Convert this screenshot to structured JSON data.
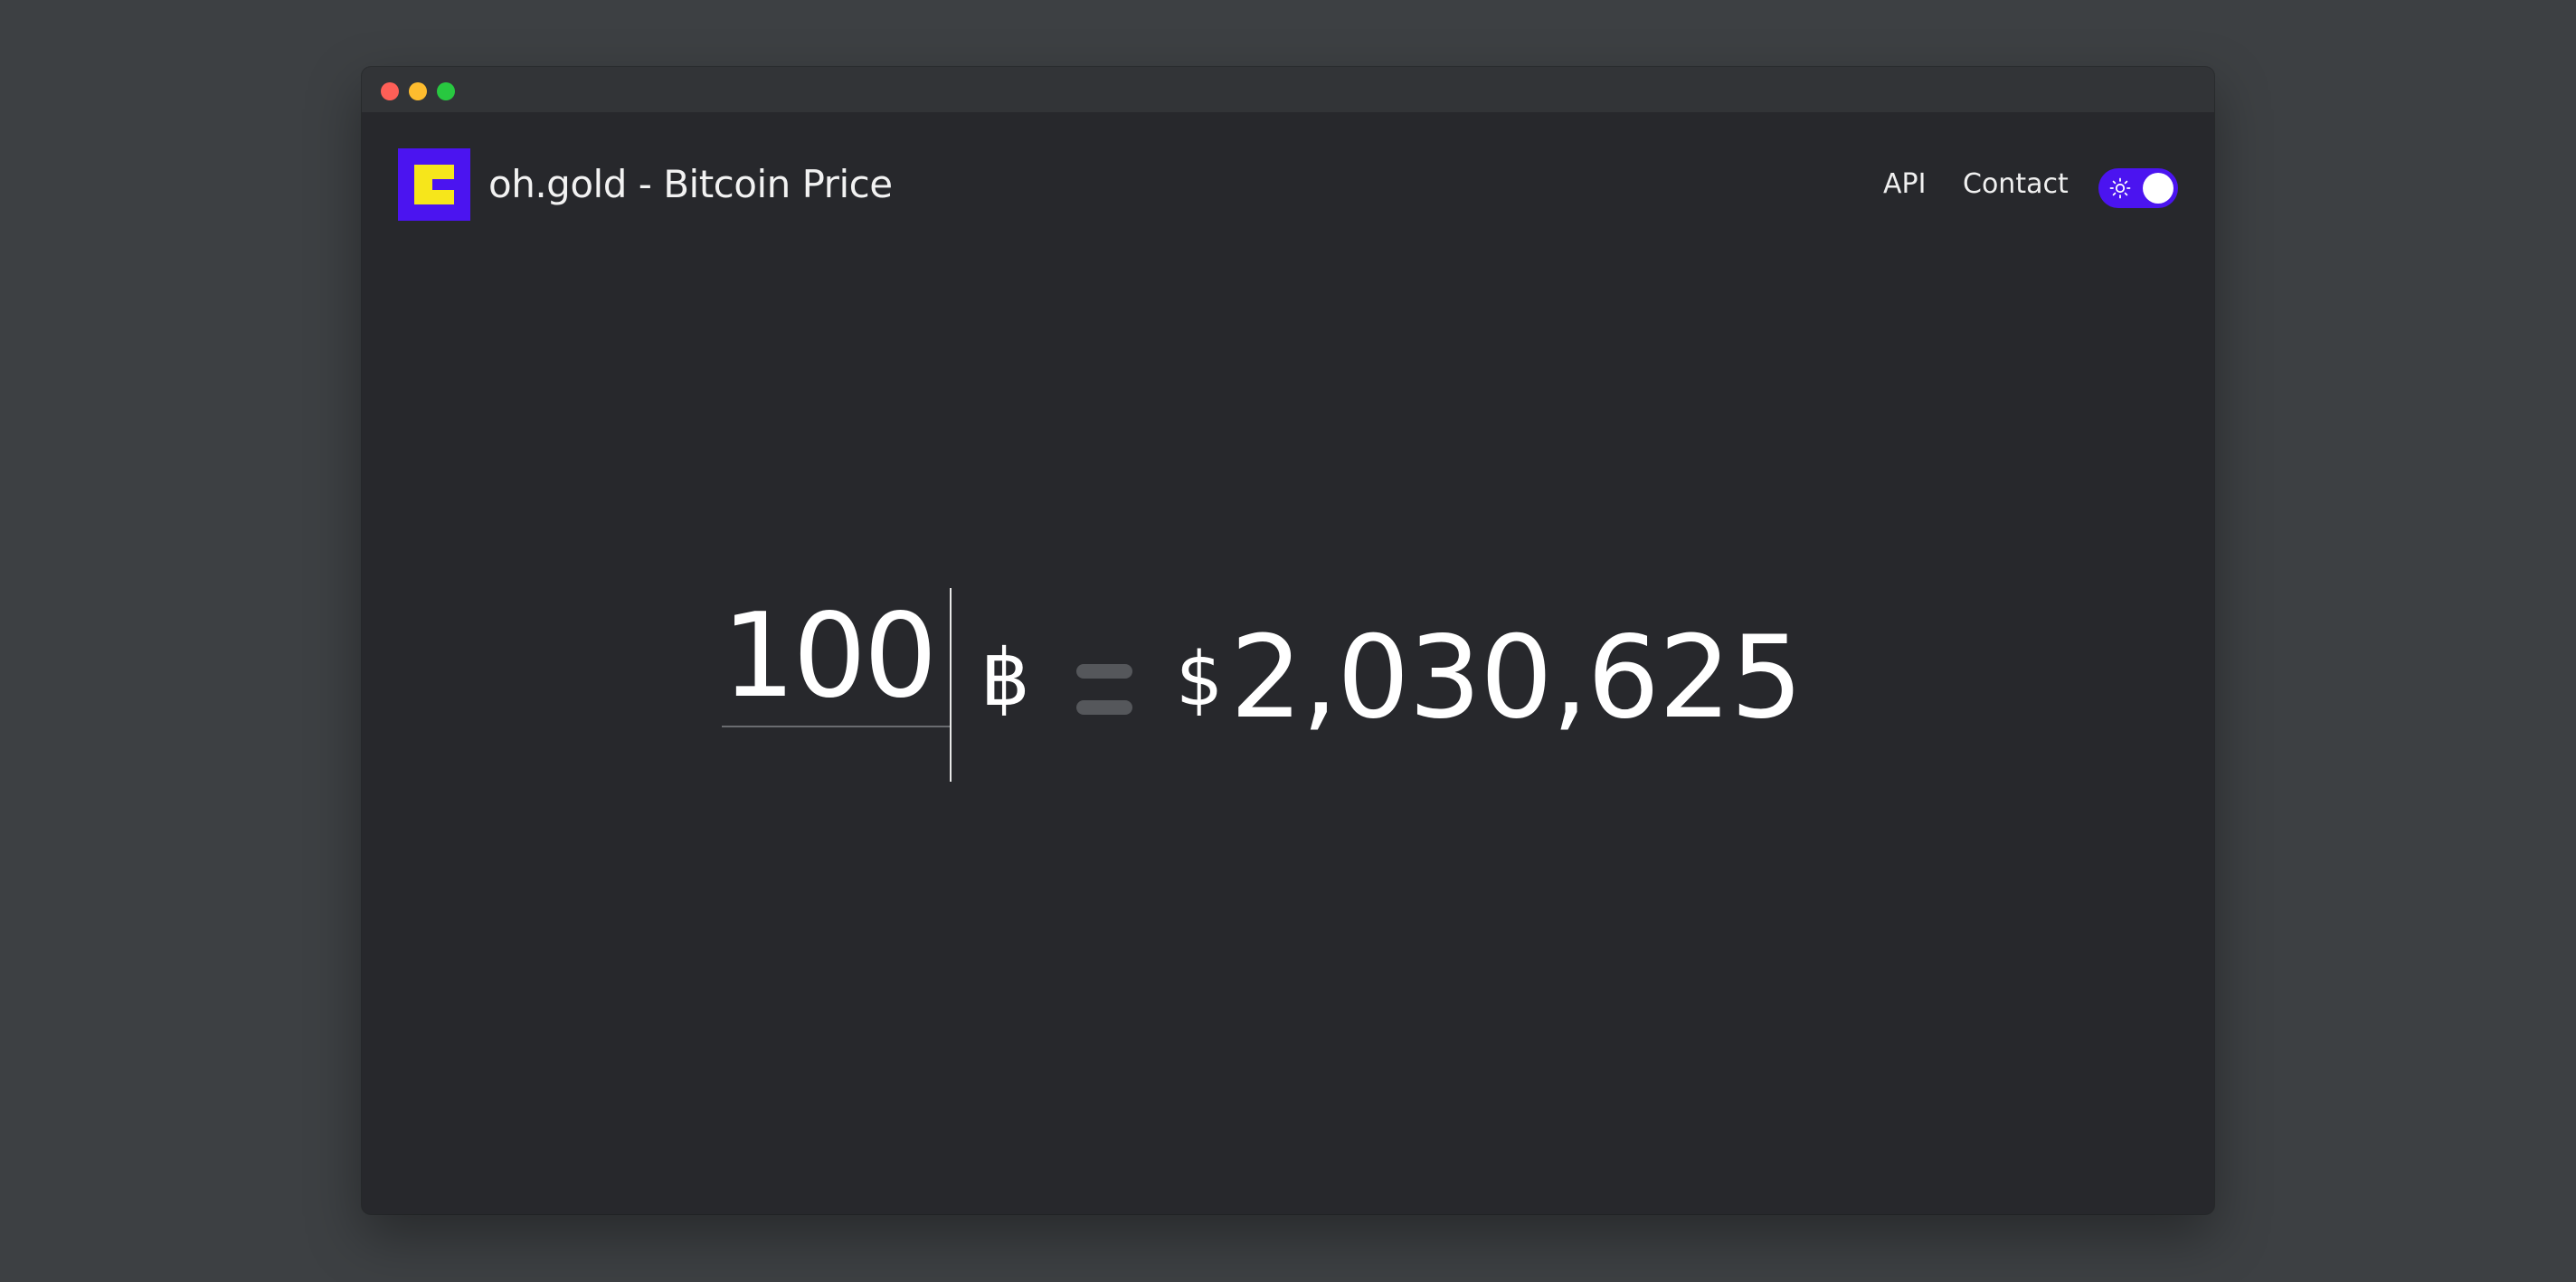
{
  "window": {
    "controls": [
      "close",
      "minimize",
      "zoom"
    ]
  },
  "header": {
    "logo_icon": "oh-gold-logo-icon",
    "title": "oh.gold - Bitcoin Price",
    "nav": [
      {
        "label": "API"
      },
      {
        "label": "Contact"
      }
    ],
    "theme_toggle": {
      "icon": "sun-icon",
      "state": "on"
    }
  },
  "converter": {
    "amount": "100",
    "btc_symbol": "฿",
    "equals_icon": "equals-icon",
    "usd_symbol": "$",
    "usd_value": "2,030,625"
  },
  "colors": {
    "accent": "#4b14f0",
    "logo_yellow": "#f6e61b",
    "background": "#27282c",
    "outer_background": "#3d4043"
  }
}
